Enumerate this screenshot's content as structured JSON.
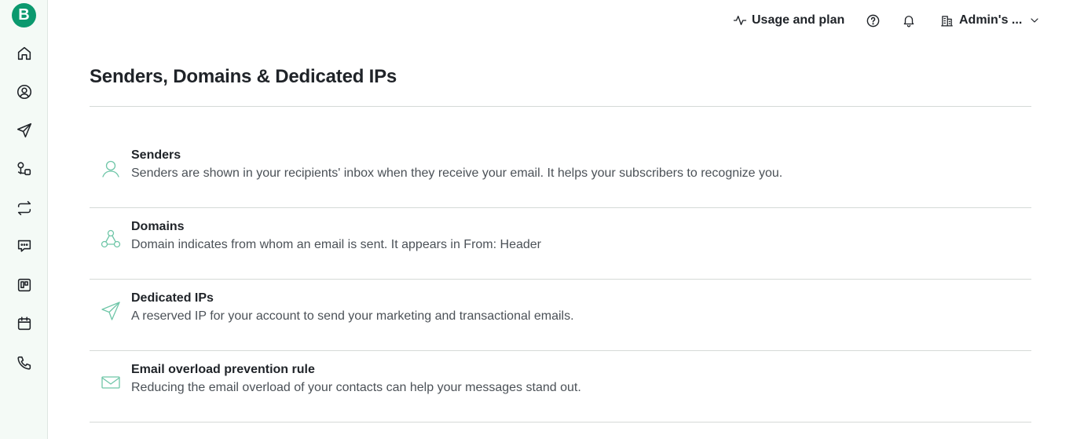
{
  "sidebar": {
    "logo_letter": "B",
    "items": [
      {
        "name": "home-icon"
      },
      {
        "name": "contacts-icon"
      },
      {
        "name": "campaigns-icon"
      },
      {
        "name": "automations-icon"
      },
      {
        "name": "transactional-icon"
      },
      {
        "name": "conversations-icon"
      },
      {
        "name": "deals-icon"
      },
      {
        "name": "meetings-icon"
      },
      {
        "name": "phone-icon"
      }
    ]
  },
  "header": {
    "usage_label": "Usage and plan",
    "account_label": "Admin's ..."
  },
  "page": {
    "title": "Senders, Domains & Dedicated IPs"
  },
  "rows": [
    {
      "title": "Senders",
      "description": "Senders are shown in your recipients' inbox when they receive your email. It helps your subscribers to recognize you.",
      "icon": "user-icon"
    },
    {
      "title": "Domains",
      "description": "Domain indicates from whom an email is sent. It appears in From: Header",
      "icon": "network-icon"
    },
    {
      "title": "Dedicated IPs",
      "description": "A reserved IP for your account to send your marketing and transactional emails.",
      "icon": "paper-plane-icon"
    },
    {
      "title": "Email overload prevention rule",
      "description": "Reducing the email overload of your contacts can help your messages stand out.",
      "icon": "envelope-icon"
    }
  ],
  "colors": {
    "brand": "#0b996e",
    "sidebar_bg": "#f4faf6",
    "row_icon": "#6fc6a8",
    "divider": "#d5dad7"
  }
}
